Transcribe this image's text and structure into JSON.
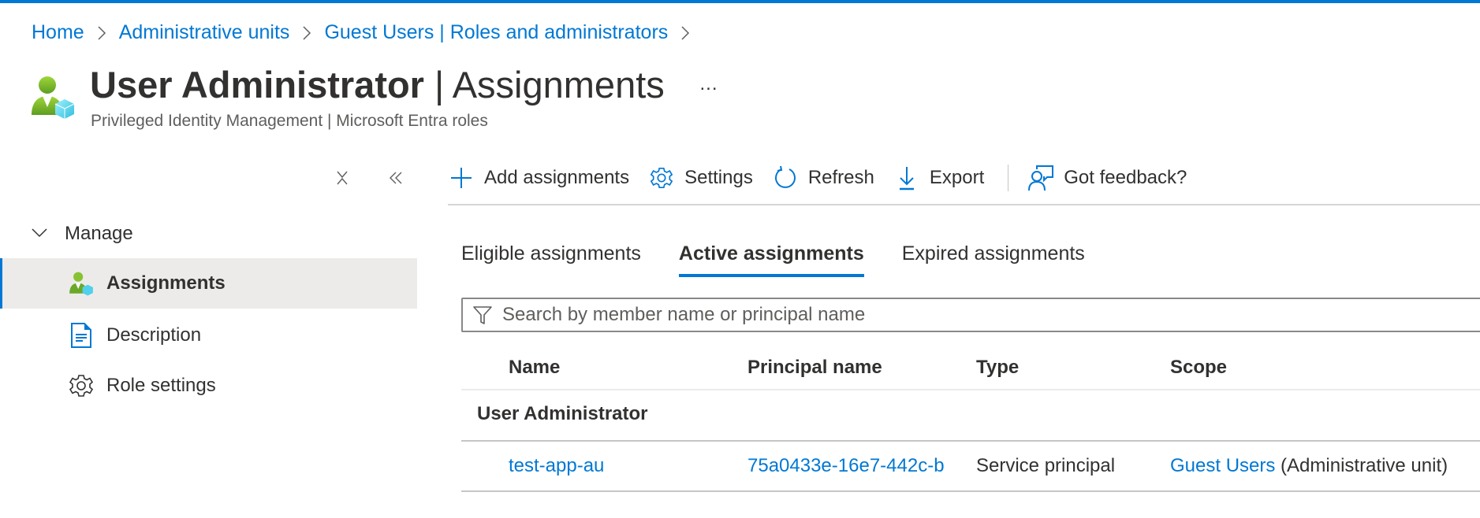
{
  "colors": {
    "accent": "#0078d4",
    "text": "#323130",
    "subtext": "#605e5c",
    "selected_bg": "#edebe9"
  },
  "breadcrumb": [
    {
      "label": "Home"
    },
    {
      "label": "Administrative units"
    },
    {
      "label": "Guest Users | Roles and administrators"
    }
  ],
  "header": {
    "icon": "user-admin-icon",
    "title_bold": "User Administrator",
    "title_separator": " | ",
    "title_rest": "Assignments",
    "more_label": "...",
    "subtitle": "Privileged Identity Management | Microsoft Entra roles"
  },
  "sidebar": {
    "collapse_icons": [
      "close-x-icon",
      "double-chevron-left-icon"
    ],
    "group": {
      "label": "Manage",
      "icon": "chevron-down-icon",
      "expanded": true
    },
    "items": [
      {
        "label": "Assignments",
        "icon": "user-admin-icon",
        "active": true
      },
      {
        "label": "Description",
        "icon": "document-icon",
        "active": false
      },
      {
        "label": "Role settings",
        "icon": "gear-icon",
        "active": false
      }
    ]
  },
  "toolbar": {
    "buttons": [
      {
        "label": "Add assignments",
        "icon": "plus-icon"
      },
      {
        "label": "Settings",
        "icon": "gear-icon"
      },
      {
        "label": "Refresh",
        "icon": "refresh-icon"
      },
      {
        "label": "Export",
        "icon": "download-icon"
      },
      {
        "label": "Got feedback?",
        "icon": "feedback-icon"
      }
    ]
  },
  "tabs": [
    {
      "label": "Eligible assignments",
      "active": false
    },
    {
      "label": "Active assignments",
      "active": true
    },
    {
      "label": "Expired assignments",
      "active": false
    }
  ],
  "search": {
    "placeholder": "Search by member name or principal name",
    "value": "",
    "icon": "filter-icon"
  },
  "table": {
    "columns": [
      "Name",
      "Principal name",
      "Type",
      "Scope"
    ],
    "groups": [
      {
        "label": "User Administrator",
        "rows": [
          {
            "name": "test-app-au",
            "principal_name": "75a0433e-16e7-442c-b",
            "type": "Service principal",
            "scope_link": "Guest Users",
            "scope_suffix": " (Administrative unit)"
          }
        ]
      }
    ]
  }
}
